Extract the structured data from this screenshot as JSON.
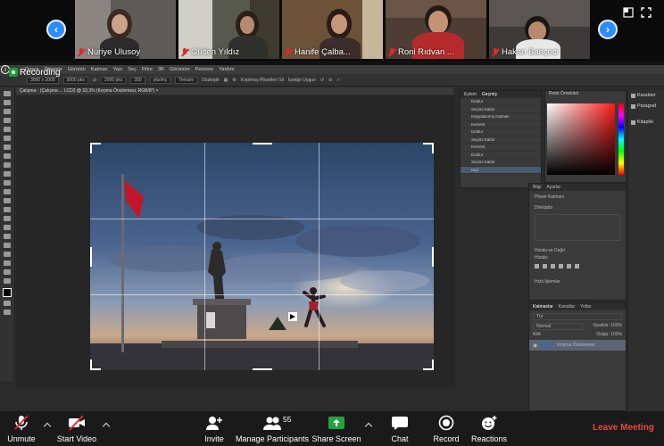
{
  "gallery": {
    "participants": [
      {
        "name": "Nuriye Ulusoy"
      },
      {
        "name": "Gülten Yıldız"
      },
      {
        "name": "Hanife Çalba..."
      },
      {
        "name": "Roni Rıdvan ..."
      },
      {
        "name": "Hakan Bahçeci"
      }
    ],
    "prev_icon": "chevron-left-icon",
    "next_icon": "chevron-right-icon"
  },
  "recording": {
    "label": "Recording"
  },
  "photoshop": {
    "menu": [
      "Dosya",
      "Düzenle",
      "Görüntü",
      "Katman",
      "Yazı",
      "Seç",
      "Filtre",
      "3B",
      "Görünüm",
      "Pencere",
      "Yardım"
    ],
    "options": {
      "ratio": "3000 x 2000",
      "w": "3000 pks",
      "h": "2000 pks",
      "res": "300",
      "unit": "pks/inç",
      "clear": "Temizle",
      "straighten": "Düzleştir",
      "delete_cropped": "Kırpılmış Pikselleri Sil",
      "content_aware": "İçeriğe Uygun"
    },
    "doc_tab": "Çalışma · (Çalışma ... LCD2 @ 33,3% (Kırpma Önizlemesi, RGB/8*) ×",
    "history_panel": {
      "tabs": [
        "Eylem",
        "Geçmiş"
      ],
      "rows": [
        "Doldur",
        "Seçimi Kaldır",
        "Kopyalanmış Katman",
        "Kement",
        "Doldur",
        "Seçimi Kaldır",
        "Kement",
        "Doldur",
        "Seçimi Kaldır",
        "Kırp"
      ]
    },
    "color_panel": {
      "title": "Renk Örnekleri"
    },
    "props_panel": {
      "tabs": [
        "Bilgi",
        "Ayarlar"
      ],
      "layer": "Piksel Katmanı",
      "transform": "Dönüştür",
      "align": "Hizala ve Dağıt",
      "align_sub": "Hizala:",
      "quick": "Hızlı İşlemler"
    },
    "layers_panel": {
      "tabs": [
        "Katmanlar",
        "Kanallar",
        "Yollar"
      ],
      "search": "Tür",
      "blend": "Normal",
      "opacity": "Opaklık: 100%",
      "lock": "Kilit:",
      "fill": "Dolgu: 100%",
      "layer_name": "Kırpma Önizlemesi"
    },
    "dock": [
      {
        "label": "Karakter",
        "icon": "character-icon"
      },
      {
        "label": "Paragraf",
        "icon": "paragraph-icon"
      },
      {
        "label": "Kitaplık",
        "icon": "library-icon"
      }
    ]
  },
  "controls": {
    "unmute": "Unmute",
    "start_video": "Start Video",
    "invite": "Invite",
    "participants": "Manage Participants",
    "participant_count": "55",
    "share": "Share Screen",
    "chat": "Chat",
    "record": "Record",
    "reactions": "Reactions",
    "leave": "Leave Meeting"
  },
  "colors": {
    "accent_blue": "#2d8cff",
    "share_green": "#23a33f",
    "leave_red": "#e74848",
    "mute_red": "#e02828"
  }
}
